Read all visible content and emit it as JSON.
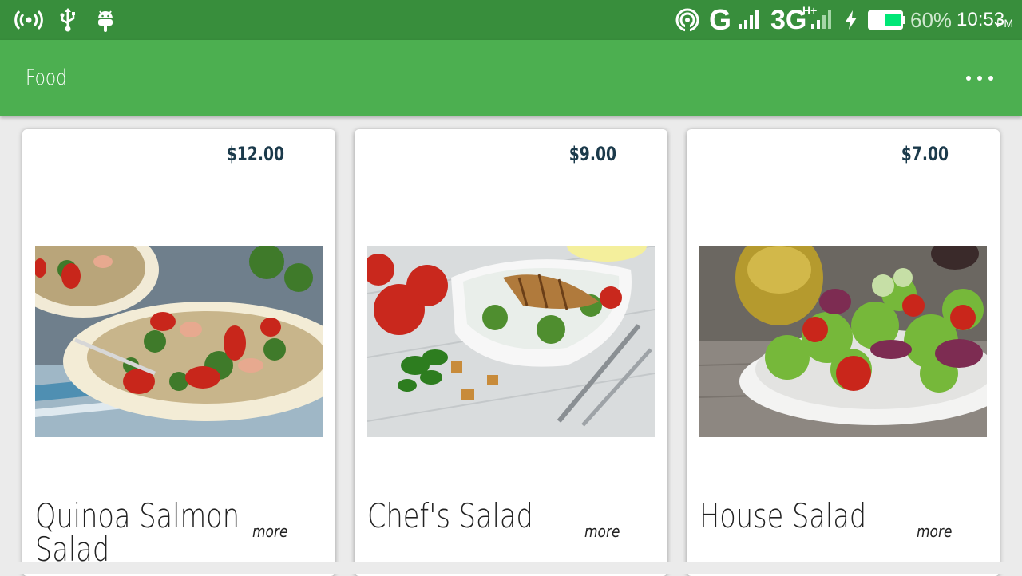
{
  "status_bar": {
    "signal_left": "radio-waves-icon",
    "usb": "usb-icon",
    "android": "android-icon",
    "hotspot": "hotspot-icon",
    "network_g": "G",
    "network_3g": "3G",
    "hplus": "H+",
    "battery_percent": "60%",
    "time": "10:53",
    "ampm": "PM"
  },
  "appbar": {
    "title": "Food"
  },
  "cards": [
    {
      "price": "$12.00",
      "name": "Quinoa Salmon Salad",
      "more": "more"
    },
    {
      "price": "$9.00",
      "name": "Chef's Salad",
      "more": "more"
    },
    {
      "price": "$7.00",
      "name": "House Salad",
      "more": "more"
    }
  ],
  "colors": {
    "status_bar": "#388e3c",
    "appbar": "#4caf50",
    "price": "#1b3a4b"
  }
}
